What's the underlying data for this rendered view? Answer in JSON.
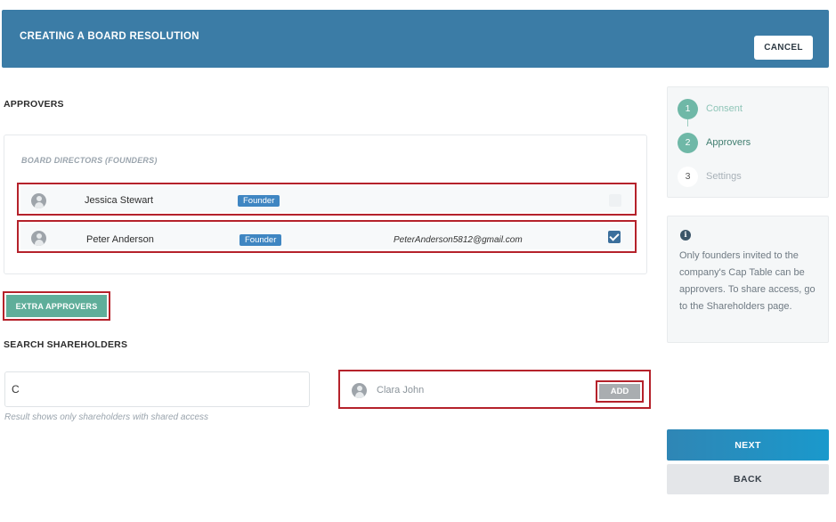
{
  "header": {
    "title": "CREATING A BOARD RESOLUTION",
    "cancel_label": "CANCEL"
  },
  "approvers": {
    "section_title": "APPROVERS",
    "directors_heading": "BOARD DIRECTORS (FOUNDERS)",
    "rows": [
      {
        "name": "Jessica Stewart",
        "badge": "Founder",
        "email": "",
        "checked": false
      },
      {
        "name": "Peter Anderson",
        "badge": "Founder",
        "email": "PeterAnderson5812@gmail.com",
        "checked": true
      }
    ],
    "extra_button_label": "EXTRA APPROVERS"
  },
  "search": {
    "section_title": "SEARCH SHAREHOLDERS",
    "input_value": "C",
    "hint": "Result shows only shareholders with shared access",
    "result": {
      "name": "Clara John",
      "add_label": "ADD"
    }
  },
  "steps": [
    {
      "number": "1",
      "label": "Consent",
      "state": "done"
    },
    {
      "number": "2",
      "label": "Approvers",
      "state": "current"
    },
    {
      "number": "3",
      "label": "Settings",
      "state": "pending"
    }
  ],
  "info": {
    "icon": "info-icon",
    "text": "Only founders invited to the company's Cap Table can be approvers. To share access, go to the Shareholders page."
  },
  "footer": {
    "next_label": "NEXT",
    "back_label": "BACK"
  },
  "colors": {
    "header_bg": "#3b7ca6",
    "accent_teal": "#5fae9a",
    "badge_blue": "#3f86c2",
    "highlight_red": "#b5222b",
    "next_button": "#1a99cc"
  }
}
